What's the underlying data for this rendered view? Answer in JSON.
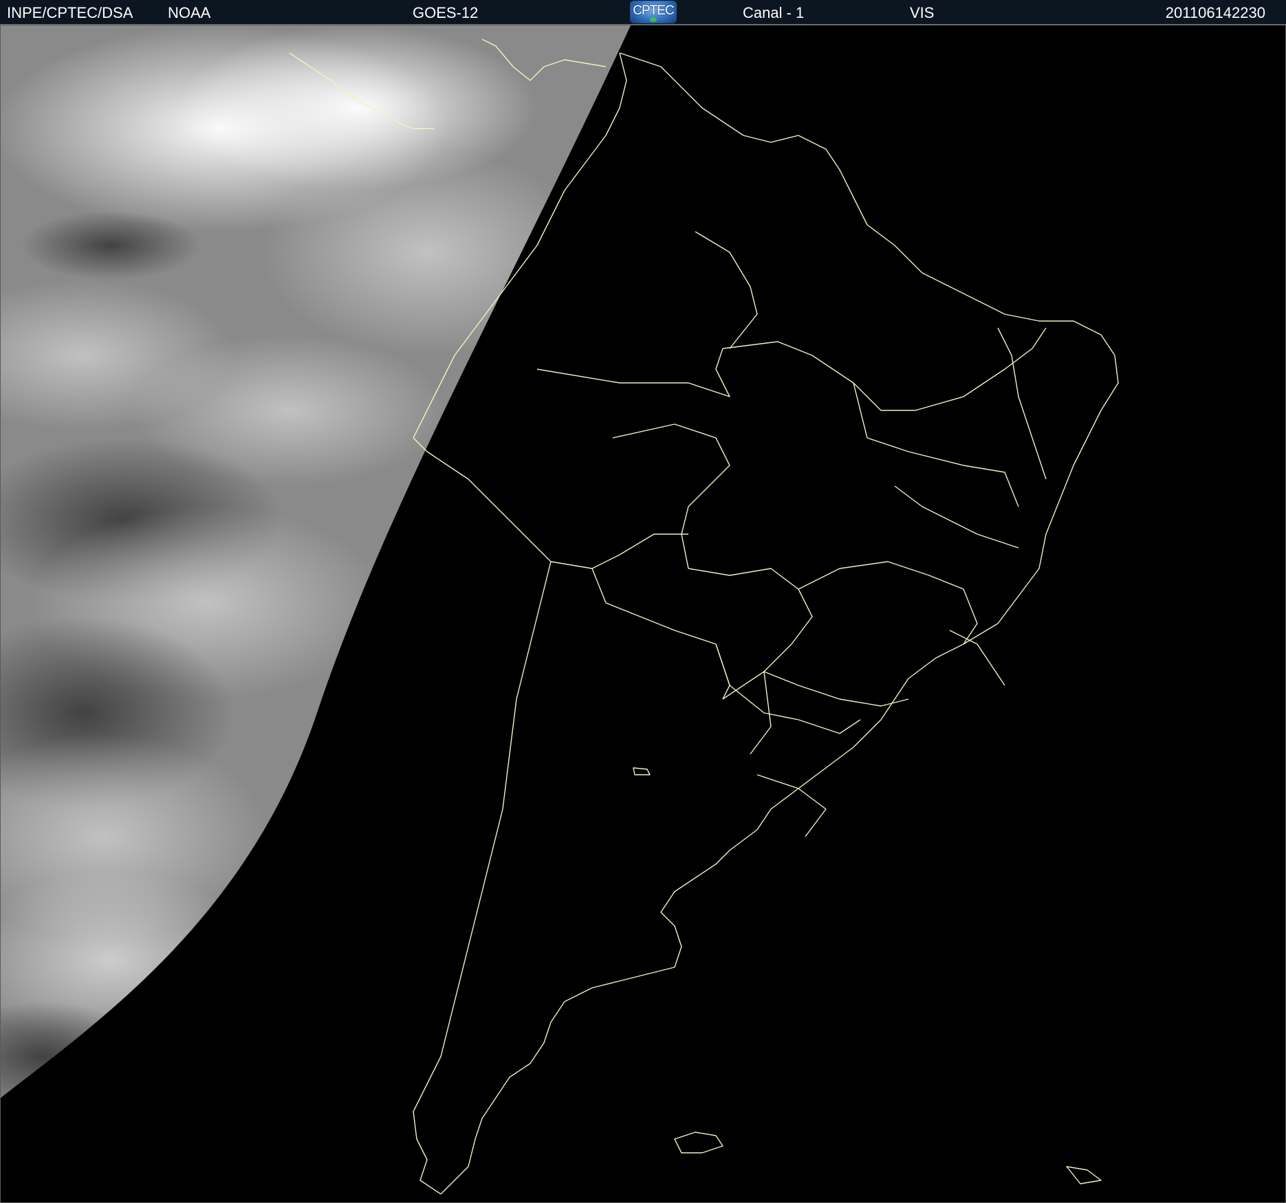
{
  "header": {
    "agency": "INPE/CPTEC/DSA",
    "source": "NOAA",
    "satellite": "GOES-12",
    "logo_text": "CPTEC",
    "channel": "Canal - 1",
    "band": "VIS",
    "timestamp": "201106142230"
  },
  "image": {
    "subject": "satellite-visible-image-south-america",
    "outline_color": "#f2f2c0",
    "dark_side_color": "#000000",
    "cloud_color": "#d9d9d9"
  }
}
